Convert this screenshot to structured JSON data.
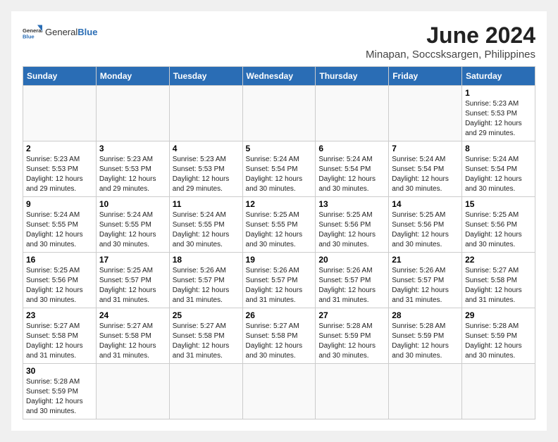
{
  "logo": {
    "text_general": "General",
    "text_blue": "Blue"
  },
  "header": {
    "month": "June 2024",
    "location": "Minapan, Soccsksargen, Philippines"
  },
  "weekdays": [
    "Sunday",
    "Monday",
    "Tuesday",
    "Wednesday",
    "Thursday",
    "Friday",
    "Saturday"
  ],
  "weeks": [
    [
      {
        "day": "",
        "info": ""
      },
      {
        "day": "",
        "info": ""
      },
      {
        "day": "",
        "info": ""
      },
      {
        "day": "",
        "info": ""
      },
      {
        "day": "",
        "info": ""
      },
      {
        "day": "",
        "info": ""
      },
      {
        "day": "1",
        "info": "Sunrise: 5:23 AM\nSunset: 5:53 PM\nDaylight: 12 hours and 29 minutes."
      }
    ],
    [
      {
        "day": "2",
        "info": "Sunrise: 5:23 AM\nSunset: 5:53 PM\nDaylight: 12 hours and 29 minutes."
      },
      {
        "day": "3",
        "info": "Sunrise: 5:23 AM\nSunset: 5:53 PM\nDaylight: 12 hours and 29 minutes."
      },
      {
        "day": "4",
        "info": "Sunrise: 5:23 AM\nSunset: 5:53 PM\nDaylight: 12 hours and 29 minutes."
      },
      {
        "day": "5",
        "info": "Sunrise: 5:24 AM\nSunset: 5:54 PM\nDaylight: 12 hours and 30 minutes."
      },
      {
        "day": "6",
        "info": "Sunrise: 5:24 AM\nSunset: 5:54 PM\nDaylight: 12 hours and 30 minutes."
      },
      {
        "day": "7",
        "info": "Sunrise: 5:24 AM\nSunset: 5:54 PM\nDaylight: 12 hours and 30 minutes."
      },
      {
        "day": "8",
        "info": "Sunrise: 5:24 AM\nSunset: 5:54 PM\nDaylight: 12 hours and 30 minutes."
      }
    ],
    [
      {
        "day": "9",
        "info": "Sunrise: 5:24 AM\nSunset: 5:55 PM\nDaylight: 12 hours and 30 minutes."
      },
      {
        "day": "10",
        "info": "Sunrise: 5:24 AM\nSunset: 5:55 PM\nDaylight: 12 hours and 30 minutes."
      },
      {
        "day": "11",
        "info": "Sunrise: 5:24 AM\nSunset: 5:55 PM\nDaylight: 12 hours and 30 minutes."
      },
      {
        "day": "12",
        "info": "Sunrise: 5:25 AM\nSunset: 5:55 PM\nDaylight: 12 hours and 30 minutes."
      },
      {
        "day": "13",
        "info": "Sunrise: 5:25 AM\nSunset: 5:56 PM\nDaylight: 12 hours and 30 minutes."
      },
      {
        "day": "14",
        "info": "Sunrise: 5:25 AM\nSunset: 5:56 PM\nDaylight: 12 hours and 30 minutes."
      },
      {
        "day": "15",
        "info": "Sunrise: 5:25 AM\nSunset: 5:56 PM\nDaylight: 12 hours and 30 minutes."
      }
    ],
    [
      {
        "day": "16",
        "info": "Sunrise: 5:25 AM\nSunset: 5:56 PM\nDaylight: 12 hours and 30 minutes."
      },
      {
        "day": "17",
        "info": "Sunrise: 5:25 AM\nSunset: 5:57 PM\nDaylight: 12 hours and 31 minutes."
      },
      {
        "day": "18",
        "info": "Sunrise: 5:26 AM\nSunset: 5:57 PM\nDaylight: 12 hours and 31 minutes."
      },
      {
        "day": "19",
        "info": "Sunrise: 5:26 AM\nSunset: 5:57 PM\nDaylight: 12 hours and 31 minutes."
      },
      {
        "day": "20",
        "info": "Sunrise: 5:26 AM\nSunset: 5:57 PM\nDaylight: 12 hours and 31 minutes."
      },
      {
        "day": "21",
        "info": "Sunrise: 5:26 AM\nSunset: 5:57 PM\nDaylight: 12 hours and 31 minutes."
      },
      {
        "day": "22",
        "info": "Sunrise: 5:27 AM\nSunset: 5:58 PM\nDaylight: 12 hours and 31 minutes."
      }
    ],
    [
      {
        "day": "23",
        "info": "Sunrise: 5:27 AM\nSunset: 5:58 PM\nDaylight: 12 hours and 31 minutes."
      },
      {
        "day": "24",
        "info": "Sunrise: 5:27 AM\nSunset: 5:58 PM\nDaylight: 12 hours and 31 minutes."
      },
      {
        "day": "25",
        "info": "Sunrise: 5:27 AM\nSunset: 5:58 PM\nDaylight: 12 hours and 31 minutes."
      },
      {
        "day": "26",
        "info": "Sunrise: 5:27 AM\nSunset: 5:58 PM\nDaylight: 12 hours and 30 minutes."
      },
      {
        "day": "27",
        "info": "Sunrise: 5:28 AM\nSunset: 5:59 PM\nDaylight: 12 hours and 30 minutes."
      },
      {
        "day": "28",
        "info": "Sunrise: 5:28 AM\nSunset: 5:59 PM\nDaylight: 12 hours and 30 minutes."
      },
      {
        "day": "29",
        "info": "Sunrise: 5:28 AM\nSunset: 5:59 PM\nDaylight: 12 hours and 30 minutes."
      }
    ],
    [
      {
        "day": "30",
        "info": "Sunrise: 5:28 AM\nSunset: 5:59 PM\nDaylight: 12 hours and 30 minutes."
      },
      {
        "day": "",
        "info": ""
      },
      {
        "day": "",
        "info": ""
      },
      {
        "day": "",
        "info": ""
      },
      {
        "day": "",
        "info": ""
      },
      {
        "day": "",
        "info": ""
      },
      {
        "day": "",
        "info": ""
      }
    ]
  ]
}
